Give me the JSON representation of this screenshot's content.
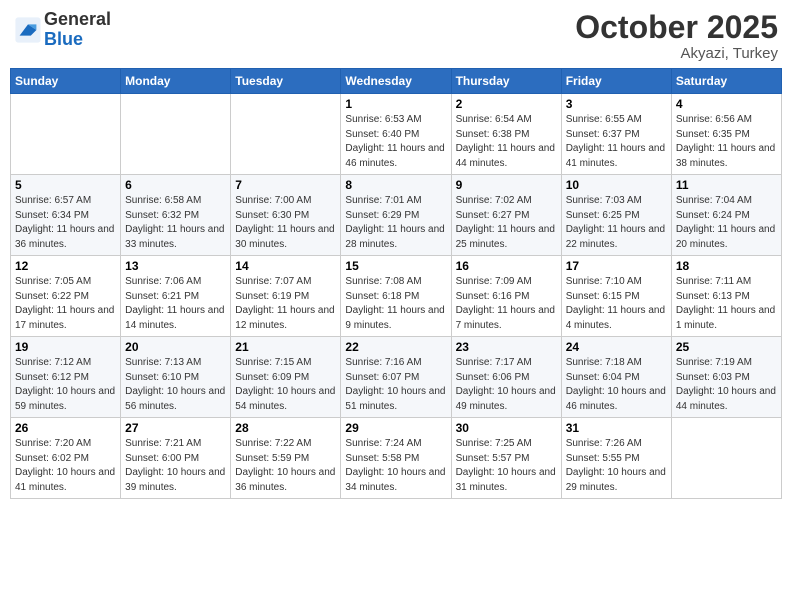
{
  "header": {
    "logo_line1": "General",
    "logo_line2": "Blue",
    "month": "October 2025",
    "location": "Akyazi, Turkey"
  },
  "weekdays": [
    "Sunday",
    "Monday",
    "Tuesday",
    "Wednesday",
    "Thursday",
    "Friday",
    "Saturday"
  ],
  "weeks": [
    [
      {
        "day": "",
        "info": ""
      },
      {
        "day": "",
        "info": ""
      },
      {
        "day": "",
        "info": ""
      },
      {
        "day": "1",
        "info": "Sunrise: 6:53 AM\nSunset: 6:40 PM\nDaylight: 11 hours and 46 minutes."
      },
      {
        "day": "2",
        "info": "Sunrise: 6:54 AM\nSunset: 6:38 PM\nDaylight: 11 hours and 44 minutes."
      },
      {
        "day": "3",
        "info": "Sunrise: 6:55 AM\nSunset: 6:37 PM\nDaylight: 11 hours and 41 minutes."
      },
      {
        "day": "4",
        "info": "Sunrise: 6:56 AM\nSunset: 6:35 PM\nDaylight: 11 hours and 38 minutes."
      }
    ],
    [
      {
        "day": "5",
        "info": "Sunrise: 6:57 AM\nSunset: 6:34 PM\nDaylight: 11 hours and 36 minutes."
      },
      {
        "day": "6",
        "info": "Sunrise: 6:58 AM\nSunset: 6:32 PM\nDaylight: 11 hours and 33 minutes."
      },
      {
        "day": "7",
        "info": "Sunrise: 7:00 AM\nSunset: 6:30 PM\nDaylight: 11 hours and 30 minutes."
      },
      {
        "day": "8",
        "info": "Sunrise: 7:01 AM\nSunset: 6:29 PM\nDaylight: 11 hours and 28 minutes."
      },
      {
        "day": "9",
        "info": "Sunrise: 7:02 AM\nSunset: 6:27 PM\nDaylight: 11 hours and 25 minutes."
      },
      {
        "day": "10",
        "info": "Sunrise: 7:03 AM\nSunset: 6:25 PM\nDaylight: 11 hours and 22 minutes."
      },
      {
        "day": "11",
        "info": "Sunrise: 7:04 AM\nSunset: 6:24 PM\nDaylight: 11 hours and 20 minutes."
      }
    ],
    [
      {
        "day": "12",
        "info": "Sunrise: 7:05 AM\nSunset: 6:22 PM\nDaylight: 11 hours and 17 minutes."
      },
      {
        "day": "13",
        "info": "Sunrise: 7:06 AM\nSunset: 6:21 PM\nDaylight: 11 hours and 14 minutes."
      },
      {
        "day": "14",
        "info": "Sunrise: 7:07 AM\nSunset: 6:19 PM\nDaylight: 11 hours and 12 minutes."
      },
      {
        "day": "15",
        "info": "Sunrise: 7:08 AM\nSunset: 6:18 PM\nDaylight: 11 hours and 9 minutes."
      },
      {
        "day": "16",
        "info": "Sunrise: 7:09 AM\nSunset: 6:16 PM\nDaylight: 11 hours and 7 minutes."
      },
      {
        "day": "17",
        "info": "Sunrise: 7:10 AM\nSunset: 6:15 PM\nDaylight: 11 hours and 4 minutes."
      },
      {
        "day": "18",
        "info": "Sunrise: 7:11 AM\nSunset: 6:13 PM\nDaylight: 11 hours and 1 minute."
      }
    ],
    [
      {
        "day": "19",
        "info": "Sunrise: 7:12 AM\nSunset: 6:12 PM\nDaylight: 10 hours and 59 minutes."
      },
      {
        "day": "20",
        "info": "Sunrise: 7:13 AM\nSunset: 6:10 PM\nDaylight: 10 hours and 56 minutes."
      },
      {
        "day": "21",
        "info": "Sunrise: 7:15 AM\nSunset: 6:09 PM\nDaylight: 10 hours and 54 minutes."
      },
      {
        "day": "22",
        "info": "Sunrise: 7:16 AM\nSunset: 6:07 PM\nDaylight: 10 hours and 51 minutes."
      },
      {
        "day": "23",
        "info": "Sunrise: 7:17 AM\nSunset: 6:06 PM\nDaylight: 10 hours and 49 minutes."
      },
      {
        "day": "24",
        "info": "Sunrise: 7:18 AM\nSunset: 6:04 PM\nDaylight: 10 hours and 46 minutes."
      },
      {
        "day": "25",
        "info": "Sunrise: 7:19 AM\nSunset: 6:03 PM\nDaylight: 10 hours and 44 minutes."
      }
    ],
    [
      {
        "day": "26",
        "info": "Sunrise: 7:20 AM\nSunset: 6:02 PM\nDaylight: 10 hours and 41 minutes."
      },
      {
        "day": "27",
        "info": "Sunrise: 7:21 AM\nSunset: 6:00 PM\nDaylight: 10 hours and 39 minutes."
      },
      {
        "day": "28",
        "info": "Sunrise: 7:22 AM\nSunset: 5:59 PM\nDaylight: 10 hours and 36 minutes."
      },
      {
        "day": "29",
        "info": "Sunrise: 7:24 AM\nSunset: 5:58 PM\nDaylight: 10 hours and 34 minutes."
      },
      {
        "day": "30",
        "info": "Sunrise: 7:25 AM\nSunset: 5:57 PM\nDaylight: 10 hours and 31 minutes."
      },
      {
        "day": "31",
        "info": "Sunrise: 7:26 AM\nSunset: 5:55 PM\nDaylight: 10 hours and 29 minutes."
      },
      {
        "day": "",
        "info": ""
      }
    ]
  ]
}
